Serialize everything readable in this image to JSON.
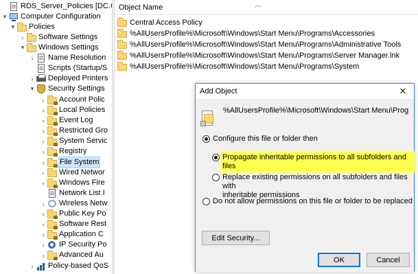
{
  "tree": {
    "items": [
      {
        "label": "RDS_Server_Policies [DC.CONTO",
        "icon": "document-icon",
        "expander": ""
      },
      {
        "label": "Computer Configuration",
        "icon": "computer-icon",
        "expander": "▾"
      },
      {
        "label": "Policies",
        "icon": "folder-icon",
        "expander": "▾"
      },
      {
        "label": "Software Settings",
        "icon": "folder-icon",
        "expander": "›"
      },
      {
        "label": "Windows Settings",
        "icon": "folder-icon",
        "expander": "▾"
      },
      {
        "label": "Name Resolution",
        "icon": "document-icon",
        "expander": "›"
      },
      {
        "label": "Scripts (Startup/S",
        "icon": "document-icon",
        "expander": ""
      },
      {
        "label": "Deployed Printers",
        "icon": "printer-icon",
        "expander": "›"
      },
      {
        "label": "Security Settings",
        "icon": "shield-icon",
        "expander": "▾"
      },
      {
        "label": "Account Polic",
        "icon": "folder-icon",
        "expander": "›"
      },
      {
        "label": "Local Policies",
        "icon": "folder-icon",
        "expander": "›"
      },
      {
        "label": "Event Log",
        "icon": "folder-icon",
        "expander": "›"
      },
      {
        "label": "Restricted Gro",
        "icon": "folder-icon",
        "expander": "›"
      },
      {
        "label": "System Servic",
        "icon": "folder-icon",
        "expander": "›"
      },
      {
        "label": "Registry",
        "icon": "folder-icon",
        "expander": "›"
      },
      {
        "label": "File System",
        "icon": "folder-icon",
        "expander": "›"
      },
      {
        "label": "Wired Networ",
        "icon": "network-icon",
        "expander": "›"
      },
      {
        "label": "Windows Fire",
        "icon": "folder-icon",
        "expander": "›"
      },
      {
        "label": "Network List I",
        "icon": "document-icon",
        "expander": ""
      },
      {
        "label": "Wireless Netw",
        "icon": "wifi-icon",
        "expander": "›"
      },
      {
        "label": "Public Key Po",
        "icon": "folder-icon",
        "expander": "›"
      },
      {
        "label": "Software Rest",
        "icon": "folder-icon",
        "expander": "›"
      },
      {
        "label": "Application C",
        "icon": "folder-icon",
        "expander": "›"
      },
      {
        "label": "IP Security Po",
        "icon": "gears-icon",
        "expander": "›"
      },
      {
        "label": "Advanced Au",
        "icon": "folder-icon",
        "expander": "›"
      },
      {
        "label": "Policy-based QoS",
        "icon": "chart-icon",
        "expander": "›"
      }
    ]
  },
  "list": {
    "column_header": "Object Name",
    "sort_indicator": "︿",
    "items": [
      "Central Access Policy",
      "%AllUsersProfile%\\Microsoft\\Windows\\Start Menu\\Programs\\Accessories",
      "%AllUsersProfile%\\Microsoft\\Windows\\Start Menu\\Programs\\Administrative Tools",
      "%AllUsersProfile%\\Microsoft\\Windows\\Start Menu\\Programs\\Server Manager.lnk",
      "%AllUsersProfile%\\Microsoft\\Windows\\Start Menu\\Programs\\System"
    ]
  },
  "dialog": {
    "title": "Add Object",
    "close_glyph": "✕",
    "path": "%AllUsersProfile%\\Microsoft\\Windows\\Start Menu\\Programs\\Eas",
    "option_configure": "Configure this file or folder then",
    "option_propagate": "Propagate inheritable permissions to all subfolders and files",
    "option_replace": "Replace existing permissions on all subfolders and files with inheritable permissions",
    "option_replace_line1": "Replace existing permissions on all subfolders and files with",
    "option_replace_line2": "inheritable permissions",
    "option_deny": "Do not allow permissions on this file or folder to be replaced",
    "edit_security": "Edit Security...",
    "ok": "OK",
    "cancel": "Cancel",
    "highlight_color": "#ffff4d"
  }
}
